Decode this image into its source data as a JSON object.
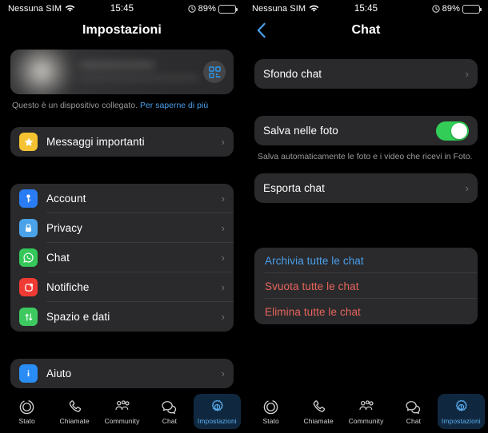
{
  "colors": {
    "accent_blue": "#4a9eea",
    "destructive_red": "#e8655c",
    "toggle_green": "#32cd57",
    "card_bg": "#2a2a2c",
    "active_tab_bg": "#10283f",
    "active_tab_fg": "#5aaef0"
  },
  "status_bar": {
    "carrier": "Nessuna SIM",
    "wifi_icon": "wifi-icon",
    "time": "15:45",
    "alarm_icon": "alarm-clock-icon",
    "battery_percent": "89%",
    "battery_level": 89,
    "battery_icon": "battery-icon"
  },
  "left_panel": {
    "nav": {
      "title": "Impostazioni"
    },
    "profile": {
      "avatar_icon": "avatar-blurred-icon",
      "qr_icon": "qr-code-icon",
      "name_redacted": true
    },
    "caption": {
      "text": "Questo è un dispositivo collegato.",
      "link": "Per saperne di più"
    },
    "highlight_group": [
      {
        "label": "Messaggi importanti",
        "icon": "star-icon",
        "icon_color": "#f5c231",
        "chevron": "›"
      }
    ],
    "main_group": [
      {
        "label": "Account",
        "icon": "key-icon",
        "icon_color": "#2a7cf5",
        "chevron": "›"
      },
      {
        "label": "Privacy",
        "icon": "lock-icon",
        "icon_color": "#4aa3e8",
        "chevron": "›"
      },
      {
        "label": "Chat",
        "icon": "whatsapp-icon",
        "icon_color": "#35c759",
        "chevron": "›"
      },
      {
        "label": "Notifiche",
        "icon": "bell-icon",
        "icon_color": "#f03b34",
        "chevron": "›"
      },
      {
        "label": "Spazio e dati",
        "icon": "data-arrows-icon",
        "icon_color": "#3dc95f",
        "chevron": "›"
      }
    ],
    "help_group": [
      {
        "label": "Aiuto",
        "icon": "info-icon",
        "icon_color": "#2a8cf5",
        "chevron": "›"
      }
    ]
  },
  "right_panel": {
    "nav": {
      "back_icon": "chevron-left-icon",
      "title": "Chat"
    },
    "wallpaper_group": [
      {
        "label": "Sfondo chat",
        "chevron": "›"
      }
    ],
    "save_group": {
      "label": "Salva nelle foto",
      "toggle_on": true,
      "footer": "Salva automaticamente le foto e i video che ricevi in Foto."
    },
    "export_group": [
      {
        "label": "Esporta chat",
        "chevron": "›"
      }
    ],
    "actions_group": [
      {
        "label": "Archivia tutte le chat",
        "style": "blue"
      },
      {
        "label": "Svuota tutte le chat",
        "style": "red"
      },
      {
        "label": "Elimina tutte le chat",
        "style": "red"
      }
    ]
  },
  "tab_bar": [
    {
      "label": "Stato",
      "icon": "status-rings-icon",
      "active": false
    },
    {
      "label": "Chiamate",
      "icon": "phone-icon",
      "active": false
    },
    {
      "label": "Community",
      "icon": "community-icon",
      "active": false
    },
    {
      "label": "Chat",
      "icon": "chat-bubbles-icon",
      "active": false
    },
    {
      "label": "Impostazioni",
      "icon": "gear-icon",
      "active": true
    }
  ]
}
